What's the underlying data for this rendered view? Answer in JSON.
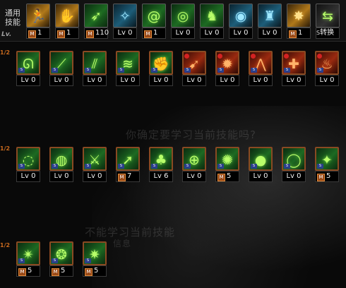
{
  "common": {
    "label": "通用技能",
    "lv_mark": "Lv."
  },
  "row_marker": "1/2",
  "background_text": {
    "line1": "你确定要学习当前技能吗?",
    "line2": "不能学习当前技能",
    "line3": "信息"
  },
  "top_row": [
    {
      "name": "common-skill-1",
      "icon": "runner-icon",
      "color": "gold",
      "level_text": "1",
      "has_m": true
    },
    {
      "name": "common-skill-2",
      "icon": "flame-hand-icon",
      "color": "gold",
      "level_text": "1",
      "has_m": true
    },
    {
      "name": "common-skill-3",
      "icon": "leap-icon",
      "color": "green",
      "level_text": "110",
      "has_m": true
    },
    {
      "name": "common-skill-4",
      "icon": "wings-icon",
      "color": "teal",
      "level_text": "Lv 0",
      "has_m": false
    },
    {
      "name": "common-skill-5",
      "icon": "spiral-icon",
      "color": "green",
      "level_text": "1",
      "has_m": true
    },
    {
      "name": "common-skill-6",
      "icon": "target-icon",
      "color": "green",
      "level_text": "Lv 0",
      "has_m": false
    },
    {
      "name": "common-skill-7",
      "icon": "beast-icon",
      "color": "green",
      "level_text": "Lv 0",
      "has_m": false
    },
    {
      "name": "common-skill-8",
      "icon": "eye-icon",
      "color": "teal",
      "level_text": "Lv 0",
      "has_m": false
    },
    {
      "name": "common-skill-9",
      "icon": "armor-icon",
      "color": "teal",
      "level_text": "Lv 0",
      "has_m": false
    },
    {
      "name": "common-skill-10",
      "icon": "fire-burst-icon",
      "color": "gold",
      "level_text": "1",
      "has_m": true
    },
    {
      "name": "common-skill-11",
      "icon": "swap-icon",
      "color": "dark",
      "level_text": "转换",
      "has_m": false,
      "is_swap": true,
      "prefix": "S"
    }
  ],
  "row2": [
    {
      "icon": "swirl-icon",
      "color": "green",
      "level_text": "Lv 0",
      "lv": "Lv 0"
    },
    {
      "icon": "claw-icon",
      "color": "green",
      "level_text": "Lv 0"
    },
    {
      "icon": "slash-icon",
      "color": "green",
      "level_text": "Lv 0"
    },
    {
      "icon": "wave-icon",
      "color": "green",
      "level_text": "Lv 0"
    },
    {
      "icon": "fist-icon",
      "color": "green",
      "level_text": "Lv 0"
    },
    {
      "icon": "dash-icon",
      "color": "red",
      "level_text": "Lv 0",
      "red": true
    },
    {
      "icon": "burst-icon",
      "color": "red",
      "level_text": "Lv 0",
      "red": true
    },
    {
      "icon": "spikes-icon",
      "color": "red",
      "level_text": "Lv 0",
      "red": true
    },
    {
      "icon": "cross-icon",
      "color": "red",
      "level_text": "Lv 0",
      "red": true
    },
    {
      "icon": "flame-icon",
      "color": "red",
      "level_text": "Lv 0",
      "red": true
    }
  ],
  "row3": [
    {
      "icon": "vortex-icon",
      "color": "green",
      "level_text": "Lv 0"
    },
    {
      "icon": "ring-icon",
      "color": "green",
      "level_text": "Lv 0"
    },
    {
      "icon": "blade-icon",
      "color": "green",
      "level_text": "Lv 0"
    },
    {
      "icon": "arrow-icon",
      "color": "green",
      "level_text": "7",
      "has_m": true
    },
    {
      "icon": "tree-icon",
      "color": "green",
      "level_text": "Lv 6"
    },
    {
      "icon": "crosshair-icon",
      "color": "green",
      "level_text": "Lv 0"
    },
    {
      "icon": "spin-icon",
      "color": "green",
      "level_text": "5",
      "has_m": true
    },
    {
      "icon": "orb-icon",
      "color": "green",
      "level_text": "Lv 0"
    },
    {
      "icon": "halo-icon",
      "color": "green",
      "level_text": "Lv 0"
    },
    {
      "icon": "shards-icon",
      "color": "green",
      "level_text": "5",
      "has_m": true
    }
  ],
  "row4": [
    {
      "icon": "spark-icon",
      "color": "green",
      "level_text": "5",
      "has_m": true
    },
    {
      "icon": "twister-icon",
      "color": "green",
      "level_text": "5",
      "has_m": true
    },
    {
      "icon": "energy-icon",
      "color": "green",
      "level_text": "5",
      "has_m": true
    }
  ]
}
